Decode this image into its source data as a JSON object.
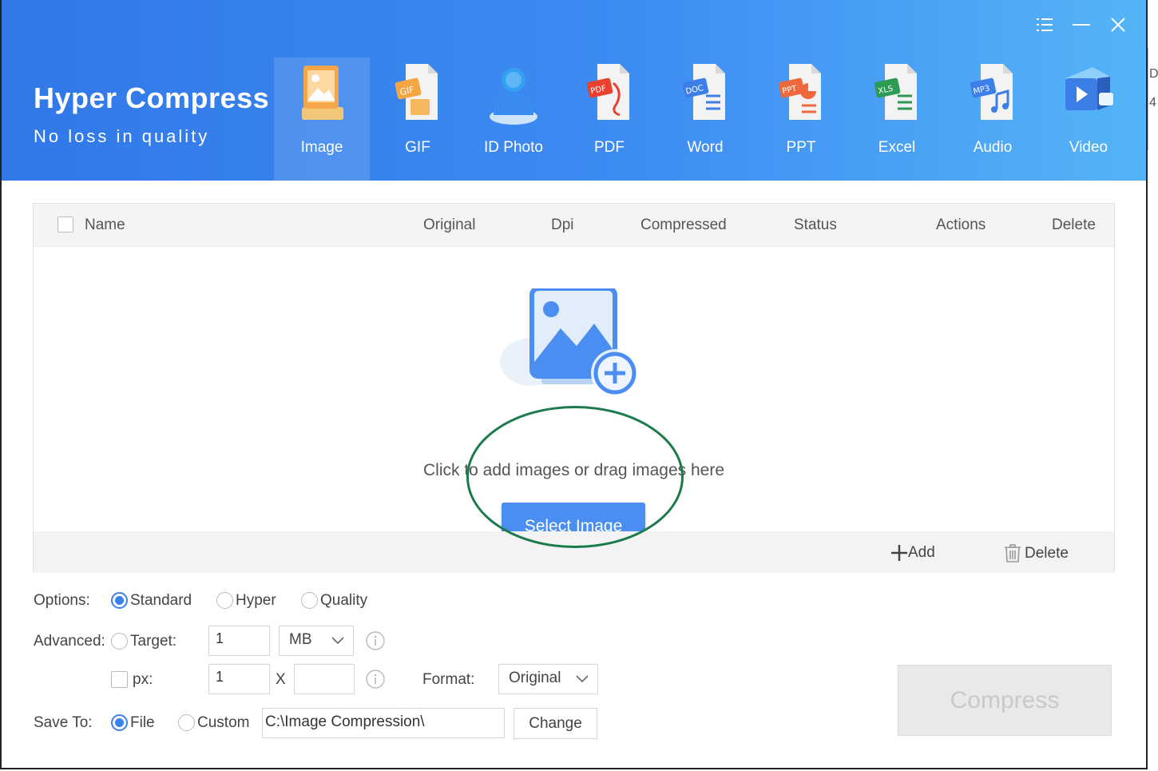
{
  "app": {
    "title": "Hyper Compress",
    "subtitle": "No loss in quality"
  },
  "tabs": [
    {
      "label": "Image",
      "icon": "image-icon",
      "active": true
    },
    {
      "label": "GIF",
      "icon": "gif-icon",
      "active": false
    },
    {
      "label": "ID Photo",
      "icon": "id-photo-icon",
      "active": false
    },
    {
      "label": "PDF",
      "icon": "pdf-icon",
      "active": false
    },
    {
      "label": "Word",
      "icon": "word-icon",
      "active": false
    },
    {
      "label": "PPT",
      "icon": "ppt-icon",
      "active": false
    },
    {
      "label": "Excel",
      "icon": "excel-icon",
      "active": false
    },
    {
      "label": "Audio",
      "icon": "audio-icon",
      "active": false
    },
    {
      "label": "Video",
      "icon": "video-icon",
      "active": false
    }
  ],
  "table": {
    "columns": {
      "name": "Name",
      "original": "Original",
      "dpi": "Dpi",
      "compressed": "Compressed",
      "status": "Status",
      "actions": "Actions",
      "delete": "Delete"
    },
    "empty_text": "Click to add images or drag images here",
    "select_button": "Select Image",
    "footer_add": "Add",
    "footer_delete": "Delete"
  },
  "options": {
    "label": "Options:",
    "modes": [
      "Standard",
      "Hyper",
      "Quality"
    ],
    "selected_mode": "Standard"
  },
  "advanced": {
    "label": "Advanced:",
    "target_label": "Target:",
    "target_value": "1",
    "target_unit": "MB",
    "px_label": "px:",
    "px_width": "1",
    "px_separator": "X",
    "px_height": "",
    "format_label": "Format:",
    "format_value": "Original"
  },
  "save_to": {
    "label": "Save To:",
    "file_label": "File",
    "custom_label": "Custom",
    "path": "C:\\Image Compression\\",
    "change_button": "Change",
    "selected": "File"
  },
  "compress_button": "Compress",
  "right_strip": {
    "fragment_top": "Da",
    "fragment_bottom": "4"
  },
  "colors": {
    "header_start": "#3178e8",
    "header_end": "#55b4f7",
    "primary_button": "#4a8ef2",
    "radio_selected": "#3b82f0",
    "annotation_circle": "#1a7a4a"
  }
}
